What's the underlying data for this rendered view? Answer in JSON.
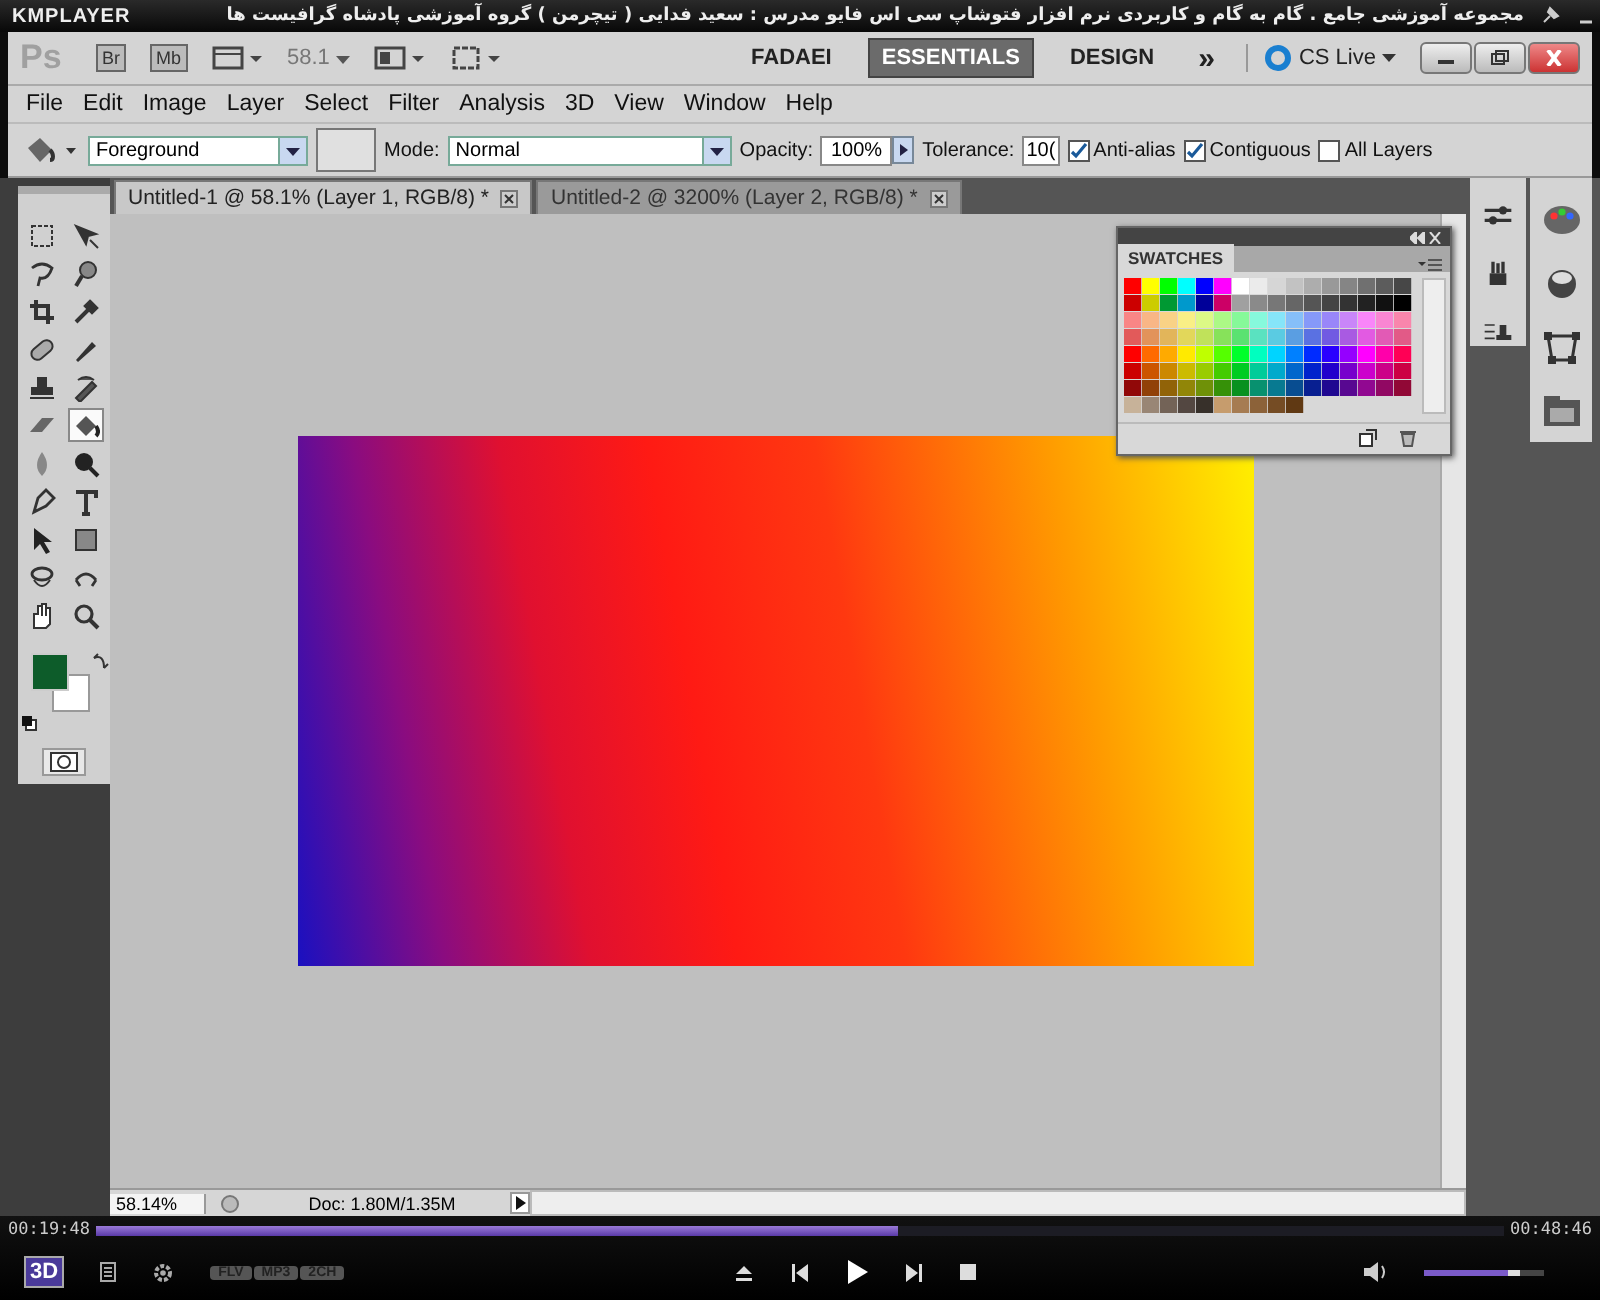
{
  "player": {
    "logo": "KMPLAYER",
    "title": "مجموعه آموزشی جامع . گام به گام و کاربردی نرم افزار فتوشاپ سی اس فایو  مدرس : سعید فدایی ( تیچرمن ) گروه آموزشی پادشاه گرافیست ها",
    "elapsed": "00:19:48",
    "total": "00:48:46",
    "progress": {
      "level": 0.57
    },
    "volume": {
      "level": 0.8
    },
    "badges": [
      "FLV",
      "MP3",
      "2CH"
    ],
    "mode_label": "3D"
  },
  "app_bar": {
    "logo": "Ps",
    "bridge": "Br",
    "mini_bridge": "Mb",
    "zoom": "58.1",
    "workspaces": [
      {
        "label": "FADAEI",
        "selected": false
      },
      {
        "label": "ESSENTIALS",
        "selected": true
      },
      {
        "label": "DESIGN",
        "selected": false
      }
    ],
    "more": "»",
    "cs_live": "CS Live"
  },
  "menu": [
    "File",
    "Edit",
    "Image",
    "Layer",
    "Select",
    "Filter",
    "Analysis",
    "3D",
    "View",
    "Window",
    "Help"
  ],
  "options": {
    "fill": "Foreground",
    "mode_label": "Mode:",
    "mode": "Normal",
    "opacity_label": "Opacity:",
    "opacity": "100%",
    "tolerance_label": "Tolerance:",
    "tolerance": "10(",
    "checks": [
      {
        "label": "Anti-alias",
        "checked": true
      },
      {
        "label": "Contiguous",
        "checked": true
      },
      {
        "label": "All Layers",
        "checked": false
      }
    ]
  },
  "documents": [
    {
      "title": "Untitled-1 @ 58.1% (Layer 1, RGB/8) *",
      "selected": true
    },
    {
      "title": "Untitled-2 @ 3200% (Layer 2, RGB/8) *",
      "selected": false
    }
  ],
  "tools": [
    {
      "selected": false
    },
    {
      "selected": false
    },
    {
      "selected": false
    },
    {
      "selected": false
    },
    {
      "selected": false
    },
    {
      "selected": false
    },
    {
      "selected": false
    },
    {
      "selected": false
    },
    {
      "selected": false
    },
    {
      "selected": false
    },
    {
      "selected": false
    },
    {
      "selected": true
    },
    {
      "selected": false
    },
    {
      "selected": false
    },
    {
      "selected": false
    },
    {
      "selected": false
    },
    {
      "selected": false
    },
    {
      "selected": false
    },
    {
      "selected": false
    },
    {
      "selected": false
    },
    {
      "selected": false
    },
    {
      "selected": false
    }
  ],
  "swatches_panel": {
    "title": "SWATCHES"
  },
  "status": {
    "zoom": "58.14%",
    "doc": "Doc: 1.80M/1.35M"
  }
}
